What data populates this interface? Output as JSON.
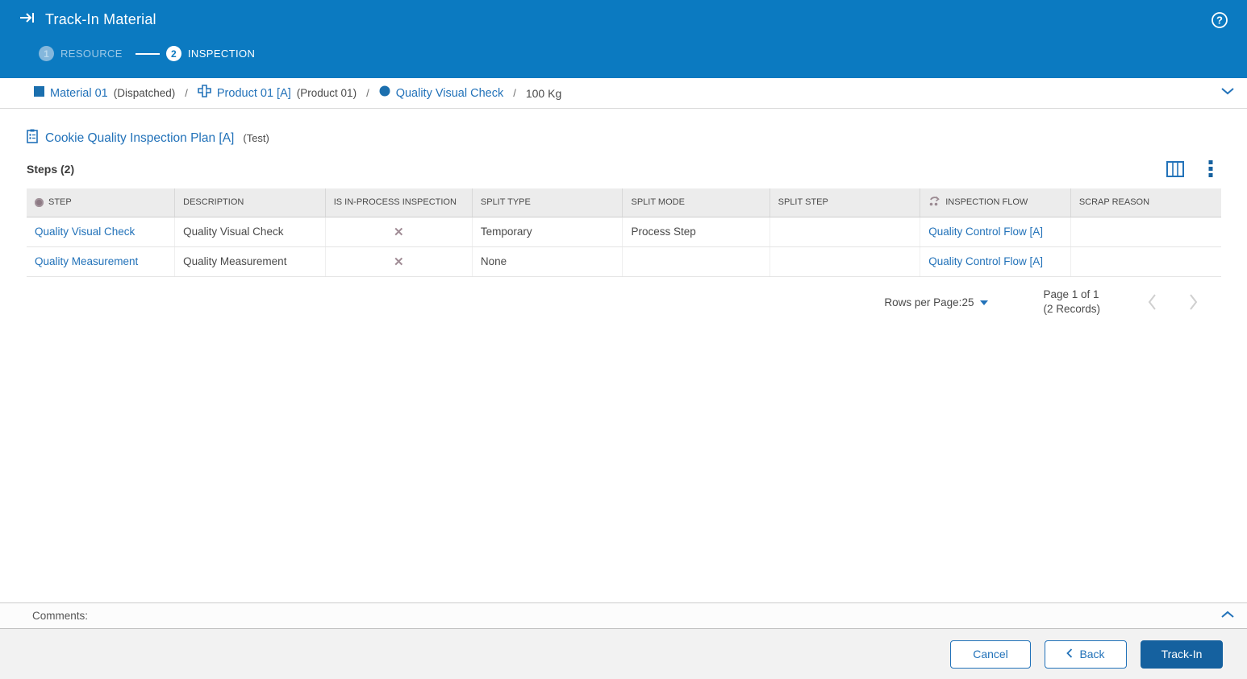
{
  "header": {
    "title": "Track-In Material",
    "steps": [
      {
        "number": "1",
        "label": "RESOURCE",
        "state": "done"
      },
      {
        "number": "2",
        "label": "INSPECTION",
        "state": "active"
      }
    ]
  },
  "breadcrumb": {
    "separator": "/",
    "items": [
      {
        "label": "Material 01",
        "sub": "(Dispatched)",
        "icon": "material-square-icon"
      },
      {
        "label": "Product 01 [A]",
        "sub": "(Product 01)",
        "icon": "product-icon"
      },
      {
        "label": "Quality Visual Check",
        "sub": "",
        "icon": "step-circle-icon"
      }
    ],
    "quantity": "100 Kg"
  },
  "plan": {
    "title": "Cookie Quality Inspection Plan [A]",
    "sub": "(Test)",
    "icon": "inspection-plan-icon"
  },
  "steps_section": {
    "title": "Steps (2)"
  },
  "table": {
    "columns": [
      "STEP",
      "DESCRIPTION",
      "IS IN-PROCESS INSPECTION",
      "SPLIT TYPE",
      "SPLIT MODE",
      "SPLIT STEP",
      "INSPECTION FLOW",
      "SCRAP REASON"
    ],
    "rows": [
      {
        "step": "Quality Visual Check",
        "description": "Quality Visual Check",
        "is_in_process": "✕",
        "split_type": "Temporary",
        "split_mode": "Process Step",
        "split_step": "",
        "inspection_flow": "Quality Control Flow [A]",
        "scrap_reason": ""
      },
      {
        "step": "Quality Measurement",
        "description": "Quality Measurement",
        "is_in_process": "✕",
        "split_type": "None",
        "split_mode": "",
        "split_step": "",
        "inspection_flow": "Quality Control Flow [A]",
        "scrap_reason": ""
      }
    ]
  },
  "pagination": {
    "rows_per_page_label": "Rows per Page:",
    "rows_per_page_value": "25",
    "page_info": "Page 1 of 1",
    "records_info": "(2 Records)"
  },
  "comments": {
    "label": "Comments:"
  },
  "footer": {
    "cancel": "Cancel",
    "back": "Back",
    "track_in": "Track-In"
  },
  "colors": {
    "header_blue": "#0b7ac1",
    "accent_blue": "#2272b9",
    "primary_button_blue": "#15619f",
    "muted_mauve": "#9b8a92",
    "header_row_gray": "#ececec",
    "footer_gray": "#f2f2f2"
  }
}
